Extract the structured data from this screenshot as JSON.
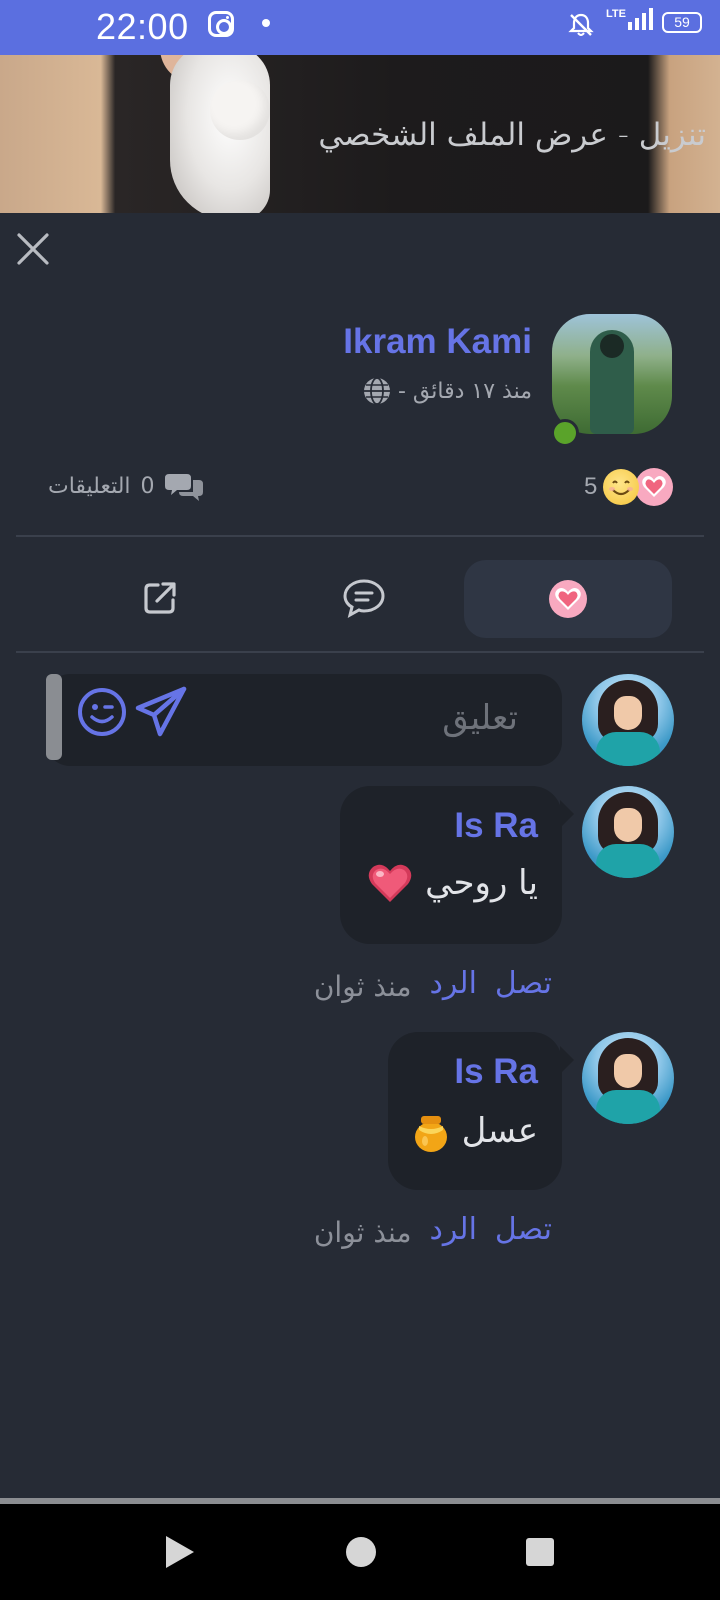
{
  "status_bar": {
    "time": "22:00",
    "network": "LTE",
    "battery": "59"
  },
  "banner": {
    "title": "تنزيل - عرض الملف الشخصي"
  },
  "post": {
    "author_name": "Ikram Kami",
    "time_ago": "منذ ١٧ دقائق -",
    "online_color": "#5aa32a",
    "comments_count": "0",
    "comments_label": "التعليقات",
    "reactions_count": "5",
    "reaction_icons": [
      "smile-emoji",
      "heart-emoji"
    ]
  },
  "actions": {
    "like_icon": "heart-icon",
    "comment_icon": "chat-bubble-icon",
    "share_icon": "external-share-icon"
  },
  "composer": {
    "placeholder": "تعليق"
  },
  "comments": [
    {
      "author": "Is Ra",
      "text": "يا روحي",
      "emoji": "heart-icon",
      "like_label": "تصل",
      "reply_label": "الرد",
      "time": "منذ ثوان"
    },
    {
      "author": "Is Ra",
      "text": "عسل",
      "emoji": "honey-pot-icon",
      "like_label": "تصل",
      "reply_label": "الرد",
      "time": "منذ ثوان"
    }
  ],
  "colors": {
    "accent": "#6674e6",
    "status_bar": "#5b6fe0",
    "background": "#262b35",
    "bubble": "#1e2229"
  }
}
